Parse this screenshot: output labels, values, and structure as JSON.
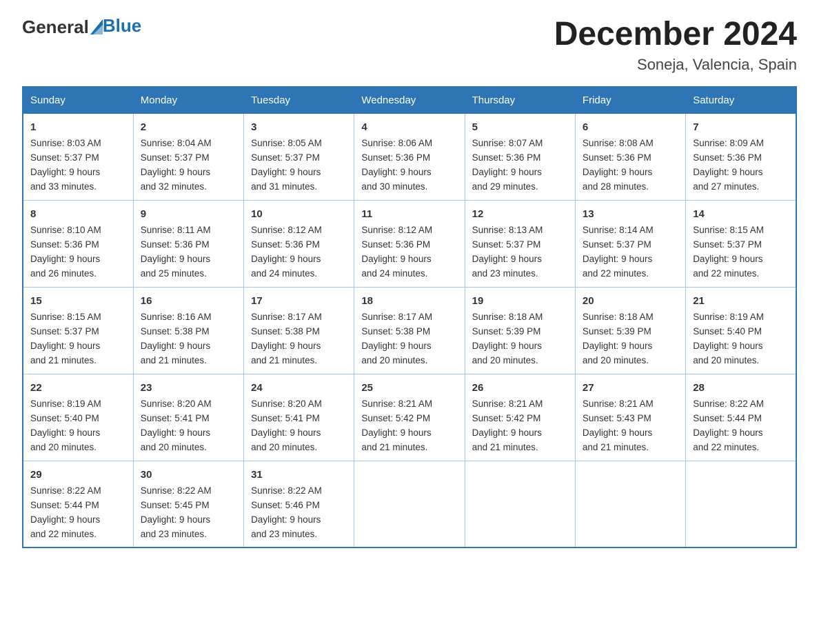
{
  "logo": {
    "general": "General",
    "blue": "Blue"
  },
  "title": "December 2024",
  "subtitle": "Soneja, Valencia, Spain",
  "days": [
    "Sunday",
    "Monday",
    "Tuesday",
    "Wednesday",
    "Thursday",
    "Friday",
    "Saturday"
  ],
  "weeks": [
    [
      {
        "day": "1",
        "sunrise": "8:03 AM",
        "sunset": "5:37 PM",
        "daylight": "9 hours and 33 minutes."
      },
      {
        "day": "2",
        "sunrise": "8:04 AM",
        "sunset": "5:37 PM",
        "daylight": "9 hours and 32 minutes."
      },
      {
        "day": "3",
        "sunrise": "8:05 AM",
        "sunset": "5:37 PM",
        "daylight": "9 hours and 31 minutes."
      },
      {
        "day": "4",
        "sunrise": "8:06 AM",
        "sunset": "5:36 PM",
        "daylight": "9 hours and 30 minutes."
      },
      {
        "day": "5",
        "sunrise": "8:07 AM",
        "sunset": "5:36 PM",
        "daylight": "9 hours and 29 minutes."
      },
      {
        "day": "6",
        "sunrise": "8:08 AM",
        "sunset": "5:36 PM",
        "daylight": "9 hours and 28 minutes."
      },
      {
        "day": "7",
        "sunrise": "8:09 AM",
        "sunset": "5:36 PM",
        "daylight": "9 hours and 27 minutes."
      }
    ],
    [
      {
        "day": "8",
        "sunrise": "8:10 AM",
        "sunset": "5:36 PM",
        "daylight": "9 hours and 26 minutes."
      },
      {
        "day": "9",
        "sunrise": "8:11 AM",
        "sunset": "5:36 PM",
        "daylight": "9 hours and 25 minutes."
      },
      {
        "day": "10",
        "sunrise": "8:12 AM",
        "sunset": "5:36 PM",
        "daylight": "9 hours and 24 minutes."
      },
      {
        "day": "11",
        "sunrise": "8:12 AM",
        "sunset": "5:36 PM",
        "daylight": "9 hours and 24 minutes."
      },
      {
        "day": "12",
        "sunrise": "8:13 AM",
        "sunset": "5:37 PM",
        "daylight": "9 hours and 23 minutes."
      },
      {
        "day": "13",
        "sunrise": "8:14 AM",
        "sunset": "5:37 PM",
        "daylight": "9 hours and 22 minutes."
      },
      {
        "day": "14",
        "sunrise": "8:15 AM",
        "sunset": "5:37 PM",
        "daylight": "9 hours and 22 minutes."
      }
    ],
    [
      {
        "day": "15",
        "sunrise": "8:15 AM",
        "sunset": "5:37 PM",
        "daylight": "9 hours and 21 minutes."
      },
      {
        "day": "16",
        "sunrise": "8:16 AM",
        "sunset": "5:38 PM",
        "daylight": "9 hours and 21 minutes."
      },
      {
        "day": "17",
        "sunrise": "8:17 AM",
        "sunset": "5:38 PM",
        "daylight": "9 hours and 21 minutes."
      },
      {
        "day": "18",
        "sunrise": "8:17 AM",
        "sunset": "5:38 PM",
        "daylight": "9 hours and 20 minutes."
      },
      {
        "day": "19",
        "sunrise": "8:18 AM",
        "sunset": "5:39 PM",
        "daylight": "9 hours and 20 minutes."
      },
      {
        "day": "20",
        "sunrise": "8:18 AM",
        "sunset": "5:39 PM",
        "daylight": "9 hours and 20 minutes."
      },
      {
        "day": "21",
        "sunrise": "8:19 AM",
        "sunset": "5:40 PM",
        "daylight": "9 hours and 20 minutes."
      }
    ],
    [
      {
        "day": "22",
        "sunrise": "8:19 AM",
        "sunset": "5:40 PM",
        "daylight": "9 hours and 20 minutes."
      },
      {
        "day": "23",
        "sunrise": "8:20 AM",
        "sunset": "5:41 PM",
        "daylight": "9 hours and 20 minutes."
      },
      {
        "day": "24",
        "sunrise": "8:20 AM",
        "sunset": "5:41 PM",
        "daylight": "9 hours and 20 minutes."
      },
      {
        "day": "25",
        "sunrise": "8:21 AM",
        "sunset": "5:42 PM",
        "daylight": "9 hours and 21 minutes."
      },
      {
        "day": "26",
        "sunrise": "8:21 AM",
        "sunset": "5:42 PM",
        "daylight": "9 hours and 21 minutes."
      },
      {
        "day": "27",
        "sunrise": "8:21 AM",
        "sunset": "5:43 PM",
        "daylight": "9 hours and 21 minutes."
      },
      {
        "day": "28",
        "sunrise": "8:22 AM",
        "sunset": "5:44 PM",
        "daylight": "9 hours and 22 minutes."
      }
    ],
    [
      {
        "day": "29",
        "sunrise": "8:22 AM",
        "sunset": "5:44 PM",
        "daylight": "9 hours and 22 minutes."
      },
      {
        "day": "30",
        "sunrise": "8:22 AM",
        "sunset": "5:45 PM",
        "daylight": "9 hours and 23 minutes."
      },
      {
        "day": "31",
        "sunrise": "8:22 AM",
        "sunset": "5:46 PM",
        "daylight": "9 hours and 23 minutes."
      },
      null,
      null,
      null,
      null
    ]
  ],
  "labels": {
    "sunrise": "Sunrise:",
    "sunset": "Sunset:",
    "daylight": "Daylight:"
  }
}
